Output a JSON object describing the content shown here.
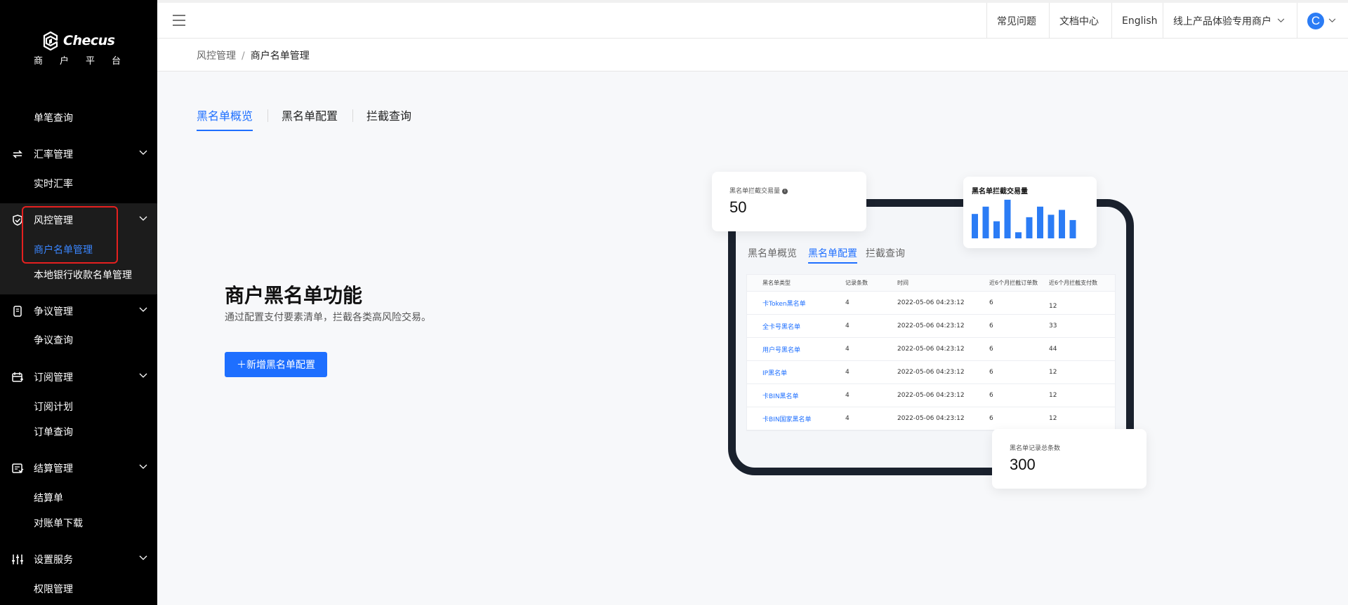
{
  "brand": {
    "name": "Checus",
    "subtitle": "商户平台"
  },
  "sidebar": {
    "items": [
      {
        "type": "item",
        "label": "单笔查询"
      },
      {
        "type": "group",
        "label": "汇率管理",
        "icon": "exchange-icon"
      },
      {
        "type": "item",
        "label": "实时汇率"
      },
      {
        "type": "group",
        "label": "风控管理",
        "icon": "shield-check-icon"
      },
      {
        "type": "item",
        "label": "商户名单管理",
        "active": true
      },
      {
        "type": "item",
        "label": "本地银行收款名单管理"
      },
      {
        "type": "group",
        "label": "争议管理",
        "icon": "phone-dispute-icon"
      },
      {
        "type": "item",
        "label": "争议查询"
      },
      {
        "type": "group",
        "label": "订阅管理",
        "icon": "calendar-sub-icon"
      },
      {
        "type": "item",
        "label": "订阅计划"
      },
      {
        "type": "item",
        "label": "订单查询"
      },
      {
        "type": "group",
        "label": "结算管理",
        "icon": "settlement-icon"
      },
      {
        "type": "item",
        "label": "结算单"
      },
      {
        "type": "item",
        "label": "对账单下载"
      },
      {
        "type": "group",
        "label": "设置服务",
        "icon": "sliders-icon"
      },
      {
        "type": "item",
        "label": "权限管理"
      }
    ]
  },
  "header": {
    "faq": "常见问题",
    "docs": "文档中心",
    "language": "English",
    "merchant": "线上产品体验专用商户",
    "avatar_letter": "C"
  },
  "breadcrumb": {
    "parent": "风控管理",
    "separator": "/",
    "current": "商户名单管理"
  },
  "tabs": [
    {
      "label": "黑名单概览",
      "active": true
    },
    {
      "label": "黑名单配置",
      "active": false
    },
    {
      "label": "拦截查询",
      "active": false
    }
  ],
  "hero": {
    "title": "商户黑名单功能",
    "subtitle": "通过配置支付要素清单，拦截各类高风险交易。",
    "button": "＋新增黑名单配置"
  },
  "illustration": {
    "intercept_card": {
      "label": "黑名单拦截交易量",
      "value": "50"
    },
    "chart_card": {
      "title": "黑名单拦截交易量"
    },
    "total_card": {
      "label": "黑名单记录总条数",
      "value": "300"
    },
    "mini_tabs": [
      "黑名单概览",
      "黑名单配置",
      "拦截查询"
    ],
    "table": {
      "headers": [
        "黑名单类型",
        "记录条数",
        "时间",
        "近6个月拦截订单数",
        "近6个月拦截支付数"
      ],
      "rows": [
        [
          "卡Token黑名单",
          "4",
          "2022-05-06 04:23:12",
          "6",
          "12"
        ],
        [
          "全卡号黑名单",
          "4",
          "2022-05-06 04:23:12",
          "6",
          "33"
        ],
        [
          "用户号黑名单",
          "4",
          "2022-05-06 04:23:12",
          "6",
          "44"
        ],
        [
          "IP黑名单",
          "4",
          "2022-05-06 04:23:12",
          "6",
          "12"
        ],
        [
          "卡BIN黑名单",
          "4",
          "2022-05-06 04:23:12",
          "6",
          "12"
        ],
        [
          "卡BIN国家黑名单",
          "4",
          "2022-05-06 04:23:12",
          "6",
          "12"
        ]
      ]
    }
  },
  "chart_data": {
    "type": "bar",
    "title": "黑名单拦截交易量",
    "values": [
      0.6,
      0.78,
      0.42,
      0.95,
      0.15,
      0.52,
      0.78,
      0.58,
      0.7,
      0.45
    ],
    "color": "#2b7cf5"
  },
  "colors": {
    "accent": "#1e6fff",
    "sidebar_bg": "#000000",
    "highlight": "#e5201f"
  }
}
